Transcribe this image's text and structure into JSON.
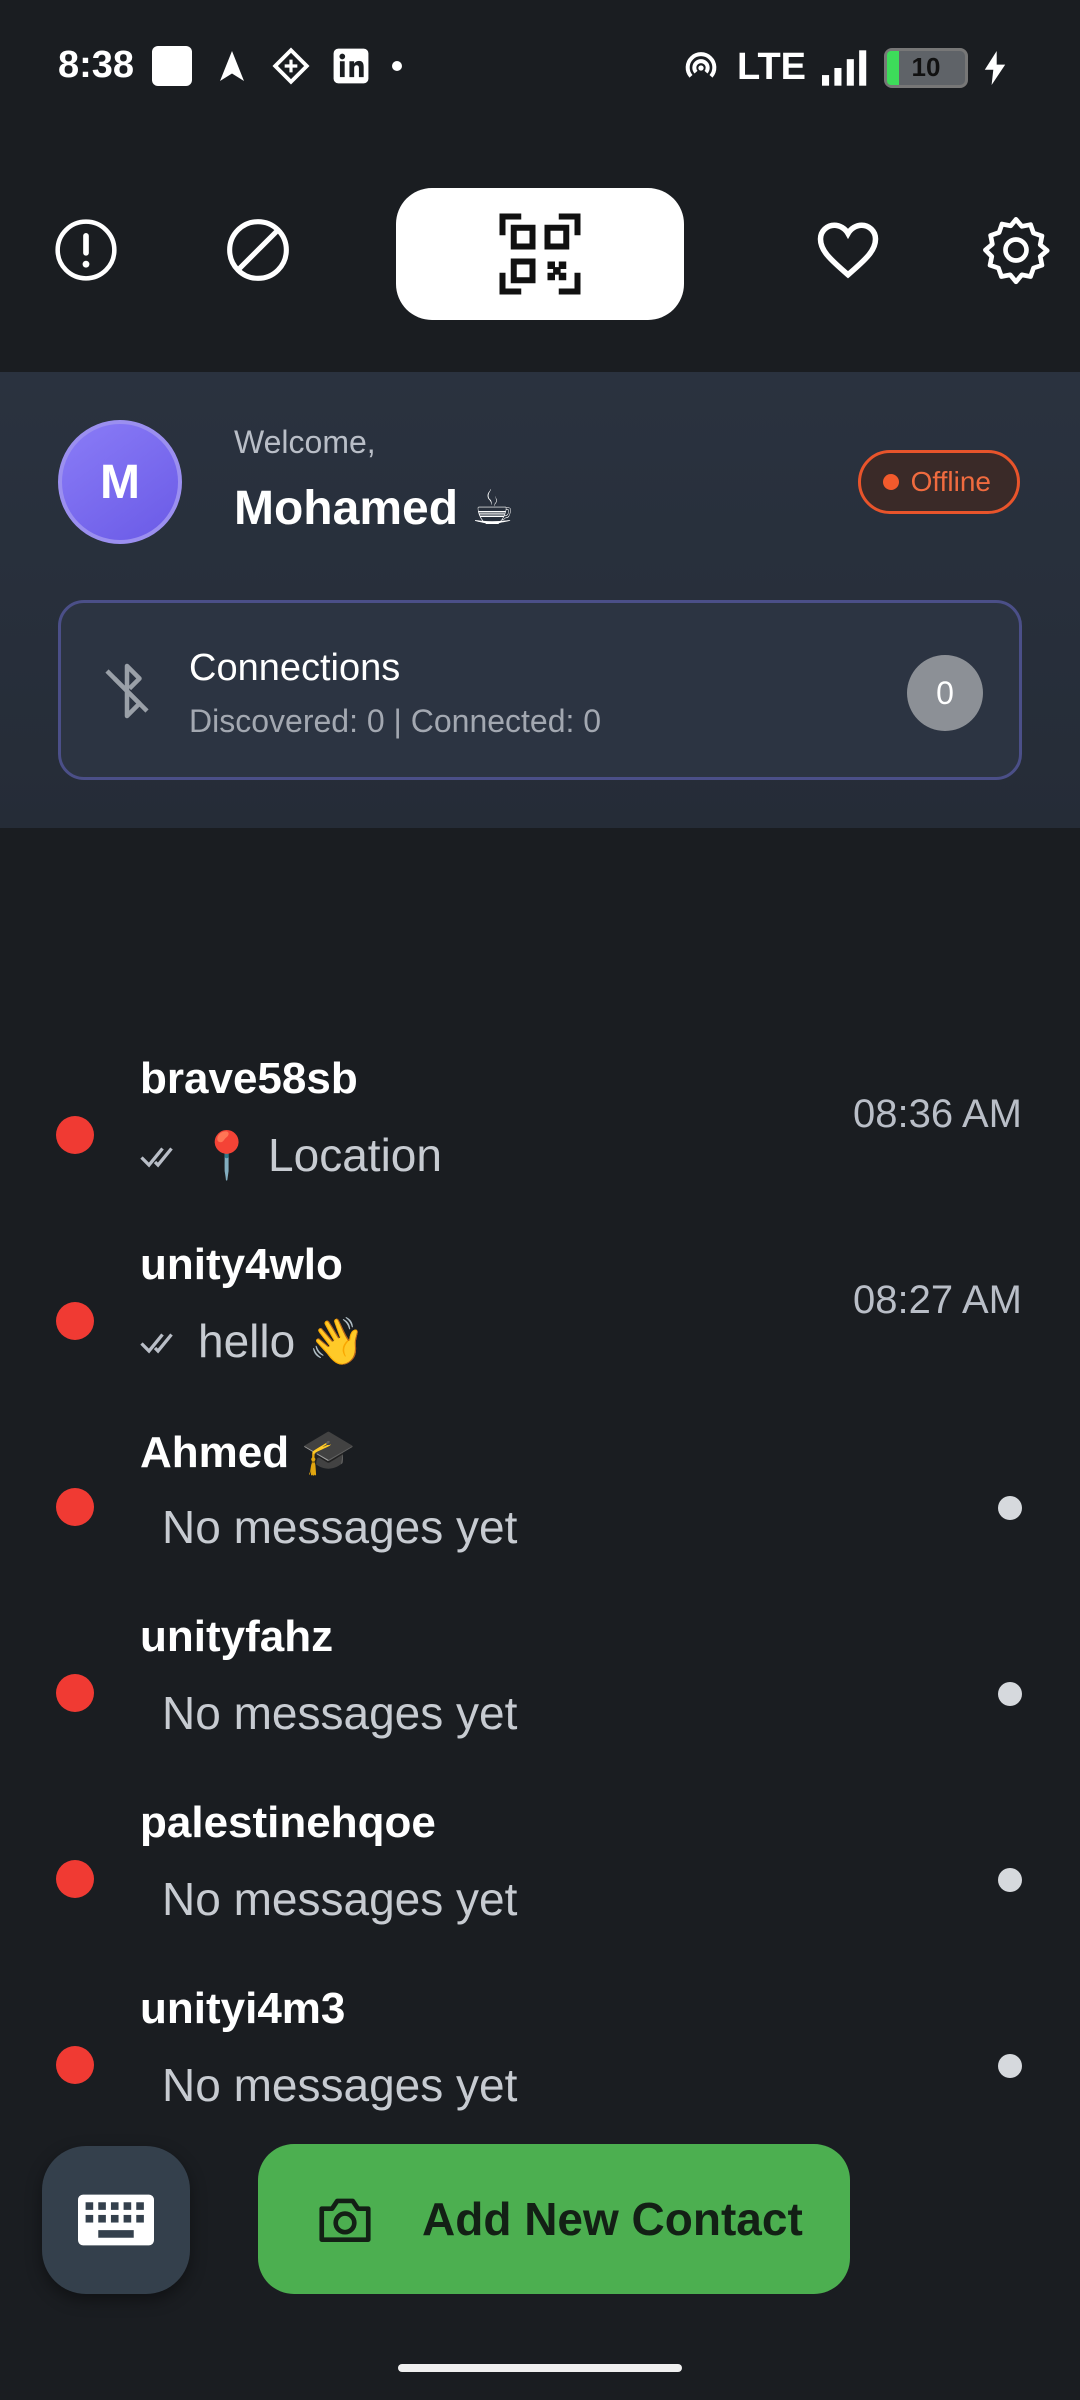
{
  "status_bar": {
    "time": "8:38",
    "network": "LTE",
    "battery": "10"
  },
  "welcome": {
    "label": "Welcome,",
    "user_name": "Mohamed ☕",
    "avatar_initial": "M",
    "status": "Offline"
  },
  "connections": {
    "title": "Connections",
    "subtitle": "Discovered: 0 | Connected: 0",
    "count": "0"
  },
  "chats": [
    {
      "name": "brave58sb",
      "preview": "📍 Location",
      "time": "08:36 AM"
    },
    {
      "name": "unity4wlo",
      "preview": "hello 👋",
      "time": "08:27 AM"
    },
    {
      "name": "Ahmed 🎓",
      "preview": "No messages yet"
    },
    {
      "name": "unityfahz",
      "preview": "No messages yet"
    },
    {
      "name": "palestinehqoe",
      "preview": "No messages yet"
    },
    {
      "name": "unityi4m3",
      "preview": "No messages yet"
    }
  ],
  "actions": {
    "add_contact": "Add New Contact"
  },
  "colors": {
    "offline": "#e8542b",
    "primary": "#4caf50",
    "avatar": "#7b6cf0",
    "unread_dot": "#f03a33"
  },
  "icons": [
    "alert-icon",
    "block-icon",
    "qr-code-icon",
    "heart-icon",
    "settings-icon",
    "bluetooth-off-icon",
    "keyboard-icon",
    "camera-icon"
  ]
}
